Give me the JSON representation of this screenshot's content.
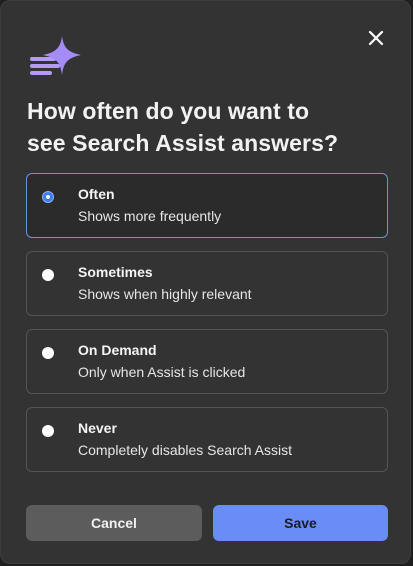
{
  "dialog": {
    "heading_line1": "How often do you want to",
    "heading_line2": "see Search Assist answers?",
    "close_label": "Close"
  },
  "options": [
    {
      "title": "Often",
      "description": "Shows more frequently",
      "selected": true
    },
    {
      "title": "Sometimes",
      "description": "Shows when highly relevant",
      "selected": false
    },
    {
      "title": "On Demand",
      "description": "Only when Assist is clicked",
      "selected": false
    },
    {
      "title": "Never",
      "description": "Completely disables Search Assist",
      "selected": false
    }
  ],
  "buttons": {
    "cancel_label": "Cancel",
    "save_label": "Save"
  },
  "colors": {
    "dialog_bg": "#333333",
    "selected_border": "#6f8fe0",
    "radio_checked": "#3d7bf0",
    "save_bg": "#6a8df5",
    "cancel_bg": "#5c5c5c",
    "logo_accent": "#b39af7"
  },
  "icons": {
    "close": "close-icon",
    "logo": "search-assist-sparkle-icon"
  }
}
